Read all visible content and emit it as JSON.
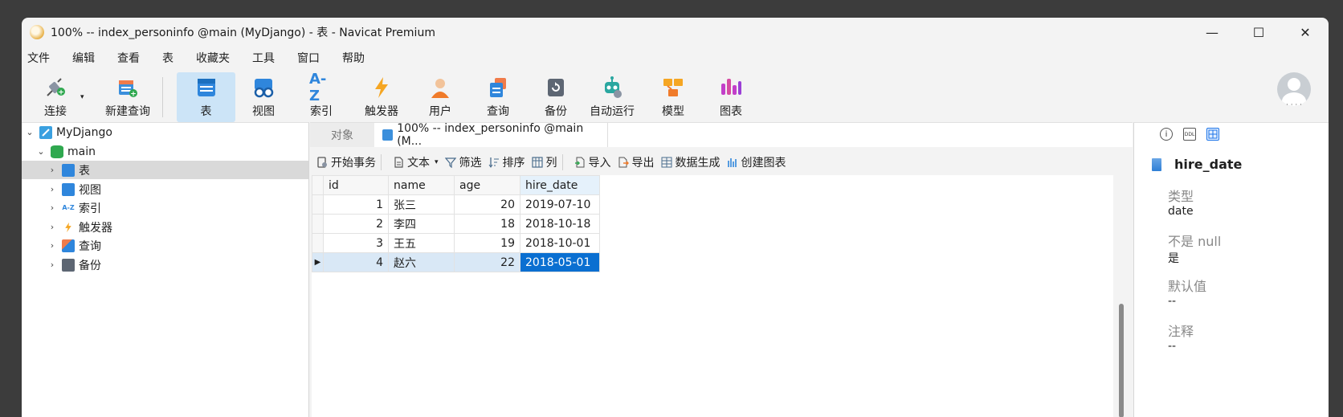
{
  "window": {
    "title": "100% -- index_personinfo @main (MyDjango) - 表 - Navicat Premium"
  },
  "controls": {
    "minimize": "—",
    "maximize": "☐",
    "close": "✕"
  },
  "menu": [
    "文件",
    "编辑",
    "查看",
    "表",
    "收藏夹",
    "工具",
    "窗口",
    "帮助"
  ],
  "toolbar": {
    "connect": "连接",
    "new_query": "新建查询",
    "table": "表",
    "view": "视图",
    "index": "索引",
    "trigger": "触发器",
    "user": "用户",
    "query": "查询",
    "backup": "备份",
    "automation": "自动运行",
    "model": "模型",
    "chart": "图表",
    "index_icon_text": "A-Z",
    "caret": "▾"
  },
  "avatar": {
    "dots": "· · · ·"
  },
  "sidebar": {
    "connection": "MyDjango",
    "database": "main",
    "items": [
      "表",
      "视图",
      "索引",
      "触发器",
      "查询",
      "备份"
    ],
    "index_icon_text": "A-Z",
    "chev_down": "⌄",
    "chev_right": "›"
  },
  "tabs": {
    "objects": "对象",
    "active": "100% -- index_personinfo @main (M..."
  },
  "subtoolbar": {
    "begin_tx": "开始事务",
    "text": "文本",
    "filter": "筛选",
    "sort": "排序",
    "columns": "列",
    "import": "导入",
    "export": "导出",
    "data_gen": "数据生成",
    "create_chart": "创建图表",
    "caret": "▾"
  },
  "grid": {
    "columns": [
      "id",
      "name",
      "age",
      "hire_date"
    ],
    "rows": [
      [
        "1",
        "张三",
        "20",
        "2019-07-10"
      ],
      [
        "2",
        "李四",
        "18",
        "2018-10-18"
      ],
      [
        "3",
        "王五",
        "19",
        "2018-10-01"
      ],
      [
        "4",
        "赵六",
        "22",
        "2018-05-01"
      ]
    ],
    "current_row_marker": "▶"
  },
  "rpanel": {
    "title": "hire_date",
    "type_label": "类型",
    "type_value": "date",
    "notnull_label": "不是 null",
    "notnull_value": "是",
    "default_label": "默认值",
    "default_value": "--",
    "comment_label": "注释",
    "comment_value": "--",
    "info_icon_text": "i",
    "ddl_icon_text": "DDL"
  }
}
